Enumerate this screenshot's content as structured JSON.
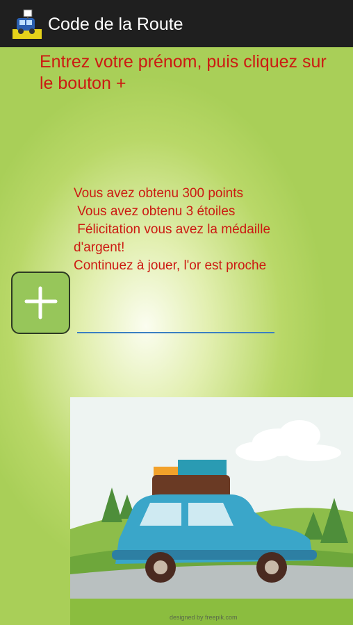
{
  "appbar": {
    "title": "Code de la Route",
    "icon": "app-logo-icon"
  },
  "instruction": "Entrez votre prénom, puis cliquez sur le bouton +",
  "result": {
    "lines": [
      "Vous avez obtenu 300 points",
      "",
      " Vous avez obtenu 3 étoiles",
      " Félicitation vous avez la médaille",
      "d'argent!",
      "Continuez à jouer, l'or est proche"
    ]
  },
  "name_input": {
    "value": ""
  },
  "add_button": {
    "icon": "plus-icon"
  },
  "illustration": {
    "credit": "designed by freepik.com"
  },
  "colors": {
    "text_red": "#cc1a12",
    "appbar": "#1f1f1f",
    "button_green": "#97c65a",
    "input_line": "#3a7fc2"
  }
}
